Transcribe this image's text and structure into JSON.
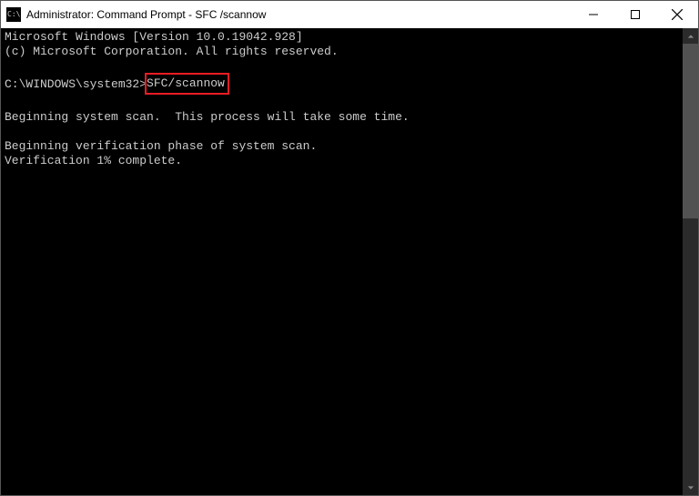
{
  "titlebar": {
    "icon_text": "C:\\.",
    "title": "Administrator: Command Prompt - SFC /scannow"
  },
  "terminal": {
    "line1": "Microsoft Windows [Version 10.0.19042.928]",
    "line2": "(c) Microsoft Corporation. All rights reserved.",
    "prompt": "C:\\WINDOWS\\system32>",
    "command": "SFC/scannow",
    "scan1": "Beginning system scan.  This process will take some time.",
    "verify1": "Beginning verification phase of system scan.",
    "verify2": "Verification 1% complete."
  }
}
